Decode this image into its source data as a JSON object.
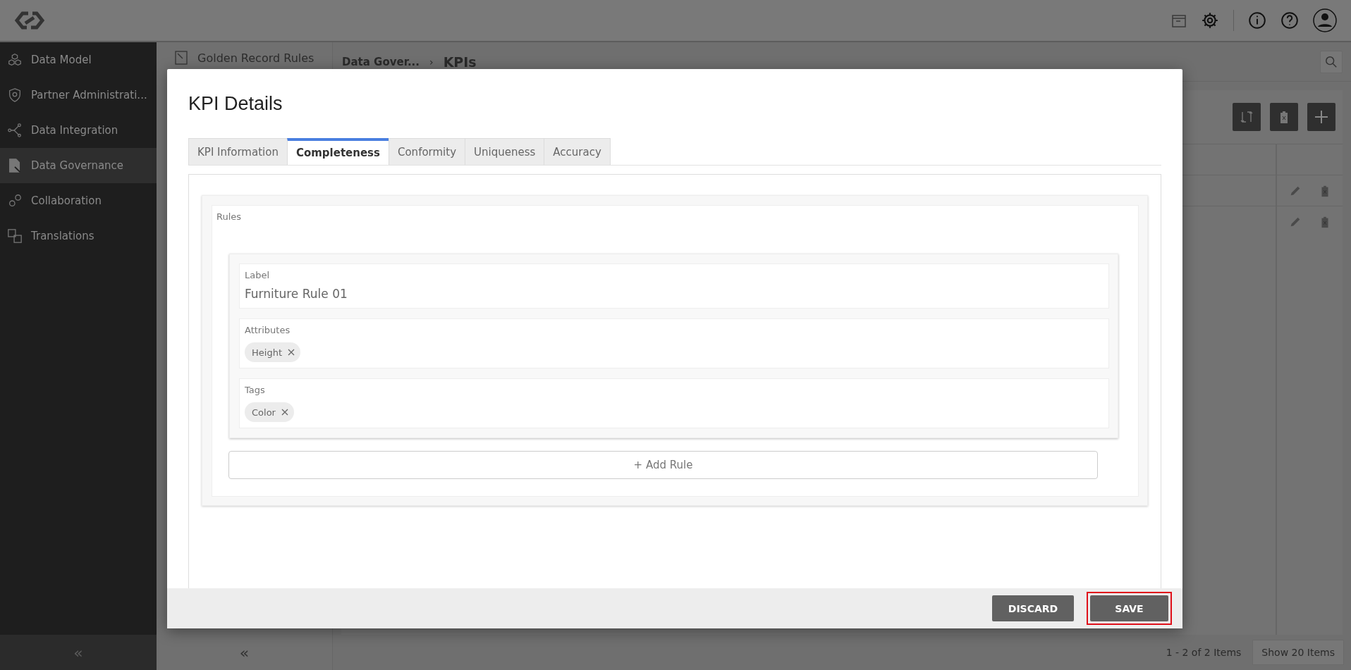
{
  "sidebar": {
    "items": [
      {
        "label": "Data Model",
        "selected": false
      },
      {
        "label": "Partner Administrati...",
        "selected": false
      },
      {
        "label": "Data Integration",
        "selected": false
      },
      {
        "label": "Data Governance",
        "selected": true
      },
      {
        "label": "Collaboration",
        "selected": false
      },
      {
        "label": "Translations",
        "selected": false
      }
    ],
    "collapse": "«"
  },
  "subpanel": {
    "item": "Golden Record Rules",
    "collapse": "«"
  },
  "breadcrumb": {
    "parent": "Data Gover...",
    "separator": "›",
    "current": "KPIs"
  },
  "pager": {
    "summary": "1 - 2 of 2 Items",
    "page_size": "Show 20 Items"
  },
  "modal": {
    "title": "KPI Details",
    "tabs": [
      {
        "label": "KPI Information",
        "selected": false
      },
      {
        "label": "Completeness",
        "selected": true
      },
      {
        "label": "Conformity",
        "selected": false
      },
      {
        "label": "Uniqueness",
        "selected": false
      },
      {
        "label": "Accuracy",
        "selected": false
      }
    ],
    "rules_title": "Rules",
    "rule": {
      "label_caption": "Label",
      "label_value": "Furniture Rule 01",
      "attributes_caption": "Attributes",
      "attributes": [
        "Height"
      ],
      "tags_caption": "Tags",
      "tags": [
        "Color"
      ]
    },
    "add_rule": "+ Add Rule",
    "buttons": [
      {
        "label": "DISCARD",
        "highlighted": false
      },
      {
        "label": "SAVE",
        "highlighted": true
      }
    ]
  }
}
